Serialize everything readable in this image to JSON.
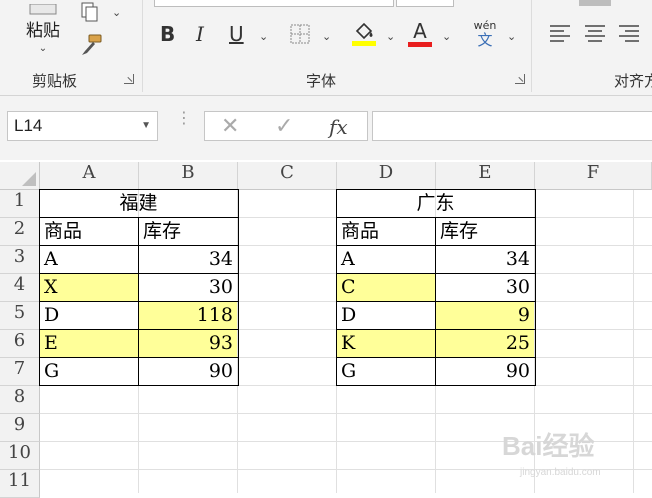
{
  "ribbon": {
    "clipboard": {
      "paste_label": "粘贴",
      "group_label": "剪贴板"
    },
    "font": {
      "group_label": "字体",
      "bold": "B",
      "italic": "I",
      "underline": "U",
      "phonetic_top": "wén",
      "phonetic_bottom": "文",
      "font_color_letter": "A"
    },
    "alignment": {
      "group_label": "对齐方"
    },
    "colors": {
      "highlight": "#ffff00",
      "font_color": "#e81e1e"
    }
  },
  "formula_bar": {
    "name_box": "L14",
    "fx": "fx",
    "formula": ""
  },
  "columns": [
    "A",
    "B",
    "C",
    "D",
    "E",
    "F"
  ],
  "rows": [
    "1",
    "2",
    "3",
    "4",
    "5",
    "6",
    "7",
    "8",
    "9",
    "10",
    "11"
  ],
  "tables": {
    "fujian": {
      "title": "福建",
      "headers": [
        "商品",
        "库存"
      ],
      "rows": [
        {
          "item": "A",
          "stock": "34"
        },
        {
          "item": "X",
          "stock": "30"
        },
        {
          "item": "D",
          "stock": "118"
        },
        {
          "item": "E",
          "stock": "93"
        },
        {
          "item": "G",
          "stock": "90"
        }
      ]
    },
    "guangdong": {
      "title": "广东",
      "headers": [
        "商品",
        "库存"
      ],
      "rows": [
        {
          "item": "A",
          "stock": "34"
        },
        {
          "item": "C",
          "stock": "30"
        },
        {
          "item": "D",
          "stock": "9"
        },
        {
          "item": "K",
          "stock": "25"
        },
        {
          "item": "G",
          "stock": "90"
        }
      ]
    }
  },
  "highlight_color": "#ffff99",
  "watermark": {
    "main": "Bai经验",
    "sub": "jingyan.baidu.com"
  }
}
